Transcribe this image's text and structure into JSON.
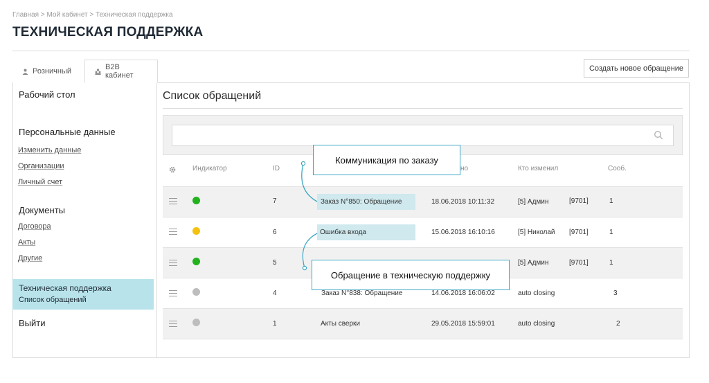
{
  "breadcrumb": "Главная > Мой кабинет > Техническая поддержка",
  "page_title": "ТЕХНИЧЕСКАЯ ПОДДЕРЖКА",
  "tabs": [
    {
      "label": "Розничный",
      "icon": "person-icon"
    },
    {
      "label": "B2B кабинет",
      "icon": "group-icon"
    }
  ],
  "create_button": "Создать новое обращение",
  "sidebar": {
    "desktop": "Рабочий стол",
    "personal_head": "Персональные данные",
    "personal_links": [
      "Изменить данные",
      "Организации",
      "Личный счет"
    ],
    "documents_head": "Документы",
    "documents_links": [
      "Договора",
      "Акты",
      "Другие"
    ],
    "active_title": "Техническая поддержка",
    "active_sub": "Список обращений",
    "exit": "Выйти"
  },
  "list_title": "Список обращений",
  "search": {
    "placeholder": "",
    "icon": "search-icon"
  },
  "columns": {
    "settings_icon": "gear-icon",
    "indicator": "Индикатор",
    "id": "ID",
    "changed_visible": "но",
    "who_changed": "Кто изменил",
    "messages": "Сооб."
  },
  "rows": [
    {
      "status": "green",
      "id": "7",
      "subject": "Заказ N°850: Обращение",
      "date": "18.06.2018 10:11:32",
      "who": "[5] Админ",
      "code": "[9701]",
      "count": "1"
    },
    {
      "status": "yellow",
      "id": "6",
      "subject": "Ошибка входа",
      "date": "15.06.2018 16:10:16",
      "who": "[5] Николай",
      "code": "[9701]",
      "count": "1"
    },
    {
      "status": "green",
      "id": "5",
      "subject": "",
      "date": "",
      "who": "[5] Админ",
      "code": "[9701]",
      "count": "1"
    },
    {
      "status": "gray",
      "id": "4",
      "subject": "Заказ N°838: Обращение",
      "date": "14.06.2018 16:06:02",
      "who": "auto closing",
      "code": "",
      "count": "3"
    },
    {
      "status": "gray",
      "id": "1",
      "subject": "Акты сверки",
      "date": "29.05.2018 15:59:01",
      "who": "auto closing",
      "code": "",
      "count": "2"
    }
  ],
  "callouts": {
    "order": "Коммуникация по заказу",
    "support": "Обращение в техническую поддержку"
  },
  "colors": {
    "accent": "#3aa6c4",
    "active_bg": "#b8e3ea",
    "green": "#22b21e",
    "yellow": "#f4c20d",
    "gray": "#bdbdbd"
  }
}
